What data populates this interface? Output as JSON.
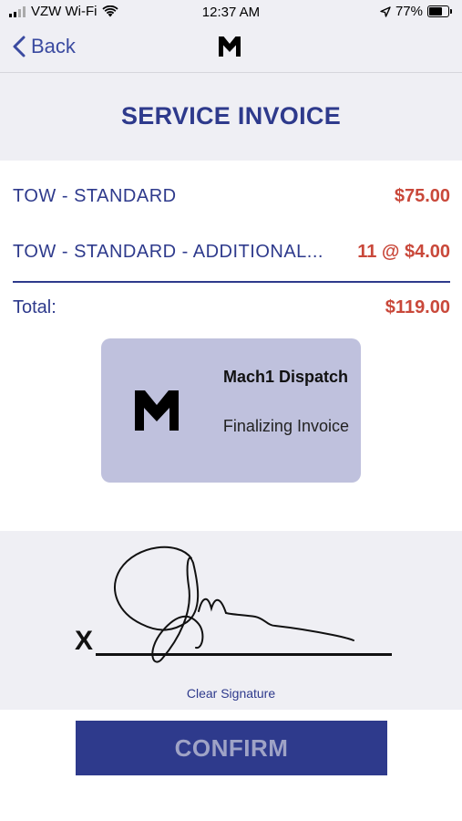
{
  "status_bar": {
    "carrier": "VZW Wi-Fi",
    "time": "12:37 AM",
    "battery_percent_label": "77%",
    "battery_level": 0.77,
    "icons": [
      "signal-icon",
      "wifi-icon",
      "location-arrow-icon",
      "battery-icon"
    ]
  },
  "nav": {
    "back_label": "Back",
    "logo": "mach1-logo"
  },
  "invoice": {
    "title": "SERVICE INVOICE",
    "items": [
      {
        "description": "TOW - STANDARD",
        "amount": "$75.00"
      },
      {
        "description": "TOW - STANDARD - ADDITIONAL...",
        "amount": "11 @ $4.00"
      }
    ],
    "total_label": "Total:",
    "total_amount": "$119.00"
  },
  "overlay": {
    "name": "Mach1 Dispatch",
    "status": "Finalizing Invoice"
  },
  "signature": {
    "x_mark": "X",
    "clear_label": "Clear Signature"
  },
  "confirm_label": "CONFIRM",
  "colors": {
    "primary": "#2e3a8c",
    "amount": "#c9483a",
    "background_gray": "#efeff4",
    "overlay": "#bfc1dd",
    "confirm_text": "#9fa3c6"
  }
}
